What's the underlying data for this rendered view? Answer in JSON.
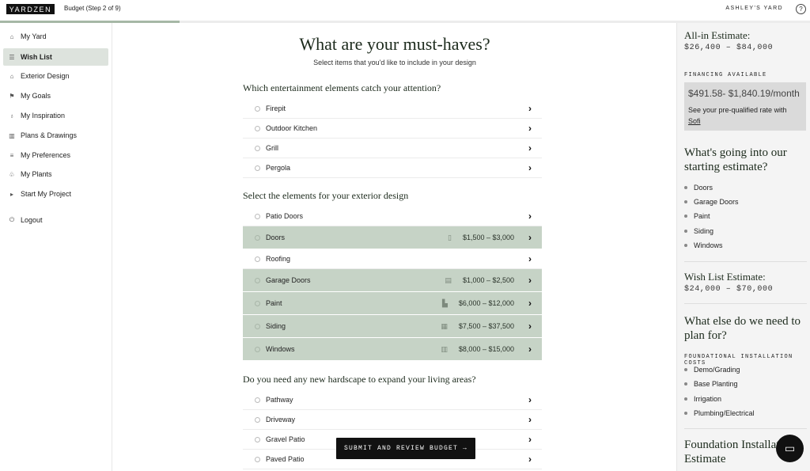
{
  "header": {
    "logo": "YARDZEN",
    "step": "Budget (Step 2 of 9)",
    "yard": "ASHLEY'S YARD",
    "help_icon": "question-circle-icon",
    "progress": 0.222
  },
  "sidebar": {
    "items": [
      {
        "label": "My Yard",
        "icon": "home-icon"
      },
      {
        "label": "Wish List",
        "icon": "list-icon",
        "active": true
      },
      {
        "label": "Exterior Design",
        "icon": "house-icon"
      },
      {
        "label": "My Goals",
        "icon": "flag-icon"
      },
      {
        "label": "My Inspiration",
        "icon": "bulb-icon"
      },
      {
        "label": "Plans & Drawings",
        "icon": "map-icon"
      },
      {
        "label": "My Preferences",
        "icon": "sliders-icon"
      },
      {
        "label": "My Plants",
        "icon": "plant-icon"
      },
      {
        "label": "Start My Project",
        "icon": "play-icon"
      }
    ],
    "logout": "Logout"
  },
  "main": {
    "title": "What are your must-haves?",
    "subtitle": "Select items that you'd like to include in your design",
    "sections": [
      {
        "title": "Which entertainment elements catch your attention?",
        "items": [
          {
            "label": "Firepit"
          },
          {
            "label": "Outdoor Kitchen"
          },
          {
            "label": "Grill"
          },
          {
            "label": "Pergola"
          }
        ]
      },
      {
        "title": "Select the elements for your exterior design",
        "items": [
          {
            "label": "Patio Doors"
          },
          {
            "label": "Doors",
            "selected": true,
            "price": "$1,500 – $3,000"
          },
          {
            "label": "Roofing"
          },
          {
            "label": "Garage Doors",
            "selected": true,
            "price": "$1,000 – $2,500"
          },
          {
            "label": "Paint",
            "selected": true,
            "price": "$6,000 – $12,000"
          },
          {
            "label": "Siding",
            "selected": true,
            "price": "$7,500 – $37,500"
          },
          {
            "label": "Windows",
            "selected": true,
            "price": "$8,000 – $15,000"
          }
        ]
      },
      {
        "title": "Do you need any new hardscape to expand your living areas?",
        "items": [
          {
            "label": "Pathway"
          },
          {
            "label": "Driveway"
          },
          {
            "label": "Gravel Patio"
          },
          {
            "label": "Paved Patio"
          }
        ]
      }
    ],
    "submit_label": "SUBMIT AND REVIEW BUDGET →"
  },
  "right": {
    "allin_title": "All-in Estimate:",
    "allin_range": "$26,400 – $84,000",
    "financing_label": "FINANCING AVAILABLE",
    "financing_amount": "$491.58- $1,840.19/month",
    "financing_text": "See your pre-qualified rate with",
    "financing_link": "Sofi",
    "starting_title": "What's going into our starting estimate?",
    "starting_items": [
      "Doors",
      "Garage Doors",
      "Paint",
      "Siding",
      "Windows"
    ],
    "wishlist_title": "Wish List Estimate:",
    "wishlist_range": "$24,000 – $70,000",
    "plan_title": "What else do we need to plan for?",
    "foundational_label": "FOUNDATIONAL INSTALLATION COSTS",
    "foundational_items": [
      "Demo/Grading",
      "Base Planting",
      "Irrigation",
      "Plumbing/Electrical"
    ],
    "foundation_title": "Foundation Installation Estimate"
  },
  "chat_icon": "chat-icon"
}
